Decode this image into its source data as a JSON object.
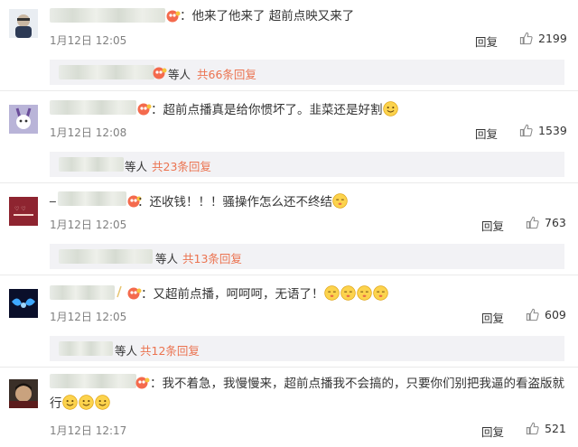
{
  "comments": [
    {
      "text": "他来了他来了 超前点映又来了",
      "time": "1月12日 12:05",
      "reply_label": "回复",
      "likes": "2199",
      "sub": {
        "etc": "等人",
        "link": "共66条回复"
      }
    },
    {
      "text": "超前点播真是给你惯坏了。韭菜还是好割",
      "time": "1月12日 12:08",
      "reply_label": "回复",
      "likes": "1539",
      "sub": {
        "etc": "等人",
        "link": "共23条回复"
      }
    },
    {
      "text": "还收钱！！！骚操作怎么还不终结",
      "time": "1月12日 12:05",
      "reply_label": "回复",
      "likes": "763",
      "sub": {
        "etc": "等人",
        "link": "共13条回复"
      }
    },
    {
      "text": "又超前点播，呵呵呵，无语了！",
      "time": "1月12日 12:05",
      "reply_label": "回复",
      "likes": "609",
      "sub": {
        "etc": "等人",
        "link": "共12条回复"
      }
    },
    {
      "text": "我不着急，我慢慢来，超前点播我不会搞的，只要你们别把我逼的看盗版就行",
      "time": "1月12日 12:17",
      "reply_label": "回复",
      "likes": "521"
    }
  ],
  "icons": {
    "like": "thumbs-up-icon",
    "smile": "smile-emoji-icon",
    "shush": "shush-emoji-icon",
    "vip_badge": "vip-badge-icon"
  },
  "colors": {
    "link": "#eb7350",
    "muted": "#808080",
    "sub_bg": "#f2f2f5"
  }
}
